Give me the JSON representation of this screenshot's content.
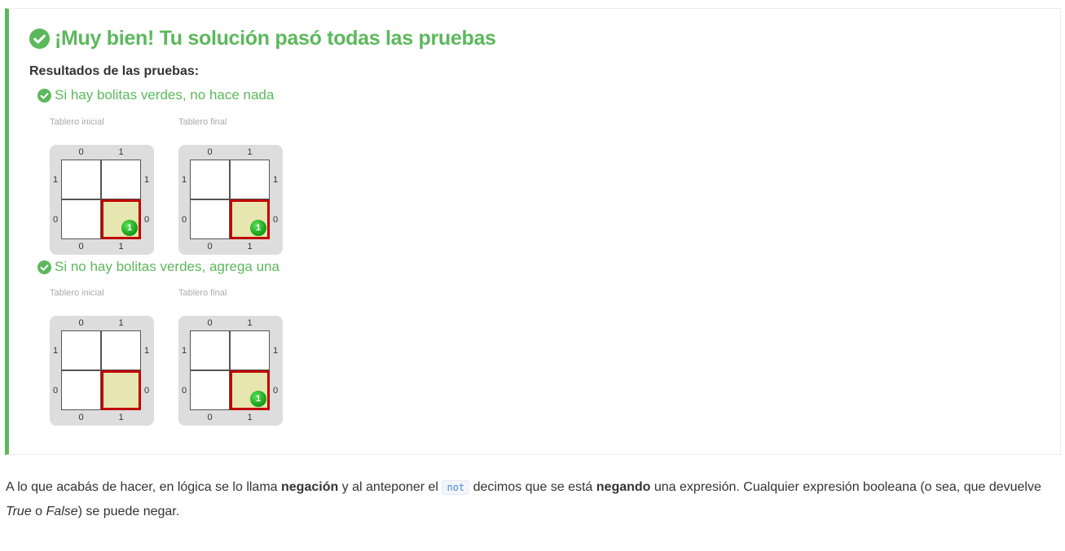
{
  "colors": {
    "success": "#5cb85c",
    "head_border": "#c00000",
    "head_fill": "#e8e6b0",
    "ball": "#1faa1f"
  },
  "result": {
    "title": "¡Muy bien! Tu solución pasó todas las pruebas",
    "title_icon": "check-circle-icon",
    "results_label": "Resultados de las pruebas:",
    "tests": [
      {
        "title": "Si hay bolitas verdes, no hace nada",
        "icon": "check-circle-icon",
        "initial_label": "Tablero inicial",
        "final_label": "Tablero final",
        "initial_board": {
          "cols": [
            "0",
            "1"
          ],
          "rows": [
            "1",
            "0"
          ],
          "head": [
            1,
            0
          ],
          "balls": [
            {
              "col": 1,
              "row": 0,
              "color": "green",
              "count": "1"
            }
          ]
        },
        "final_board": {
          "cols": [
            "0",
            "1"
          ],
          "rows": [
            "1",
            "0"
          ],
          "head": [
            1,
            0
          ],
          "balls": [
            {
              "col": 1,
              "row": 0,
              "color": "green",
              "count": "1"
            }
          ]
        }
      },
      {
        "title": "Si no hay bolitas verdes, agrega una",
        "icon": "check-circle-icon",
        "initial_label": "Tablero inicial",
        "final_label": "Tablero final",
        "initial_board": {
          "cols": [
            "0",
            "1"
          ],
          "rows": [
            "1",
            "0"
          ],
          "head": [
            1,
            0
          ],
          "balls": []
        },
        "final_board": {
          "cols": [
            "0",
            "1"
          ],
          "rows": [
            "1",
            "0"
          ],
          "head": [
            1,
            0
          ],
          "balls": [
            {
              "col": 1,
              "row": 0,
              "color": "green",
              "count": "1"
            }
          ]
        }
      }
    ]
  },
  "explanation": {
    "part1": "A lo que acabás de hacer, en lógica se lo llama ",
    "bold1": "negación",
    "part2": " y al anteponer el ",
    "code": "not",
    "part3": " decimos que se está ",
    "bold2": "negando",
    "part4": " una expresión. Cualquier expresión booleana (o sea, que devuelve ",
    "italic1": "True",
    "part5": " o ",
    "italic2": "False",
    "part6": ") se puede negar."
  }
}
